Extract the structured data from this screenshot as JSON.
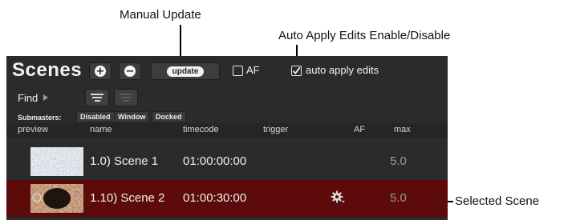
{
  "annotations": {
    "manual_update": "Manual Update",
    "auto_apply": "Auto Apply Edits Enable/Disable",
    "selected_scene": "Selected Scene"
  },
  "panel": {
    "title": "Scenes",
    "update_label": "update",
    "af_label": "AF",
    "auto_apply_label": "auto apply edits",
    "auto_apply_checked": true,
    "find_label": "Find",
    "submasters_label": "Submasters:",
    "submaster_modes": [
      "Disabled",
      "Window",
      "Docked"
    ],
    "columns": [
      "preview",
      "name",
      "timecode",
      "trigger",
      "AF",
      "max"
    ],
    "rows": [
      {
        "name": "1.0) Scene 1",
        "timecode": "01:00:00:00",
        "trigger": "",
        "af": "",
        "max": "5.0",
        "selected": false
      },
      {
        "name": "1.10) Scene 2",
        "timecode": "01:00:30:00",
        "trigger": "gear-icon",
        "af": "",
        "max": "5.0",
        "selected": true
      }
    ]
  },
  "colors": {
    "panel_bg": "#2b2b2b",
    "selected_row_bg": "#5c0a0a",
    "text": "#f2f2f2",
    "max_text": "#9a9a9a"
  }
}
